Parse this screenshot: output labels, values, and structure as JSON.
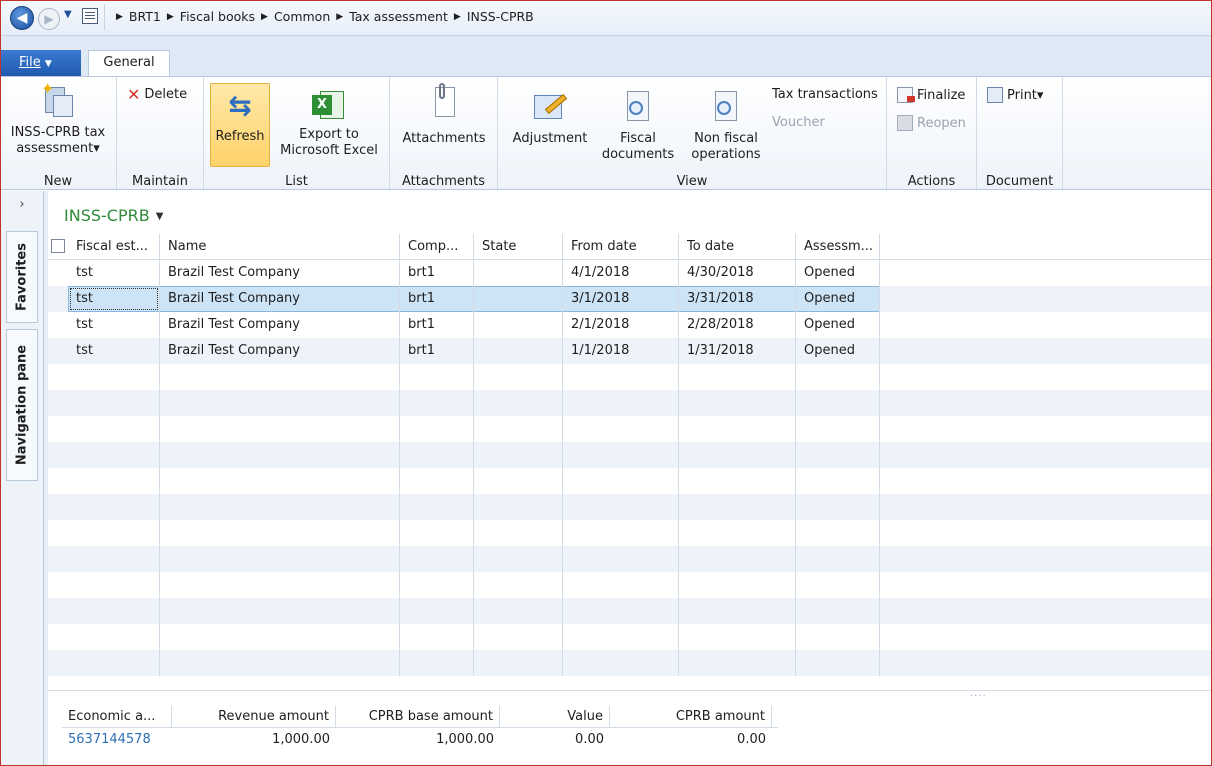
{
  "breadcrumb": [
    "BRT1",
    "Fiscal books",
    "Common",
    "Tax assessment",
    "INSS-CPRB"
  ],
  "tabs": {
    "file": "File",
    "general": "General"
  },
  "ribbon": {
    "new": {
      "button": "INSS-CPRB tax",
      "button2": "assessment▾",
      "group": "New"
    },
    "maintain": {
      "delete": "Delete",
      "group": "Maintain"
    },
    "list": {
      "refresh": "Refresh",
      "export1": "Export to",
      "export2": "Microsoft Excel",
      "group": "List"
    },
    "attachments": {
      "button": "Attachments",
      "group": "Attachments"
    },
    "view": {
      "adjustment": "Adjustment",
      "fiscal1": "Fiscal",
      "fiscal2": "documents",
      "nonfiscal1": "Non fiscal",
      "nonfiscal2": "operations",
      "tax_transactions": "Tax transactions",
      "voucher": "Voucher",
      "group": "View"
    },
    "actions": {
      "finalize": "Finalize",
      "reopen": "Reopen",
      "group": "Actions"
    },
    "document": {
      "print": "Print▾",
      "group": "Document"
    }
  },
  "side": {
    "favorites": "Favorites",
    "navigation": "Navigation pane",
    "expand": "›"
  },
  "grid": {
    "title": "INSS-CPRB",
    "columns": [
      "Fiscal est...",
      "Name",
      "Comp...",
      "State",
      "From date",
      "To date",
      "Assessm..."
    ],
    "rows": [
      [
        "tst",
        "Brazil Test Company",
        "brt1",
        "",
        "4/1/2018",
        "4/30/2018",
        "Opened"
      ],
      [
        "tst",
        "Brazil Test Company",
        "brt1",
        "",
        "3/1/2018",
        "3/31/2018",
        "Opened"
      ],
      [
        "tst",
        "Brazil Test Company",
        "brt1",
        "",
        "2/1/2018",
        "2/28/2018",
        "Opened"
      ],
      [
        "tst",
        "Brazil Test Company",
        "brt1",
        "",
        "1/1/2018",
        "1/31/2018",
        "Opened"
      ]
    ]
  },
  "summary": {
    "columns": [
      "Economic a...",
      "Revenue amount",
      "CPRB base amount",
      "Value",
      "CPRB amount"
    ],
    "values": [
      "5637144578",
      "1,000.00",
      "1,000.00",
      "0.00",
      "0.00"
    ]
  },
  "splitter": "...."
}
